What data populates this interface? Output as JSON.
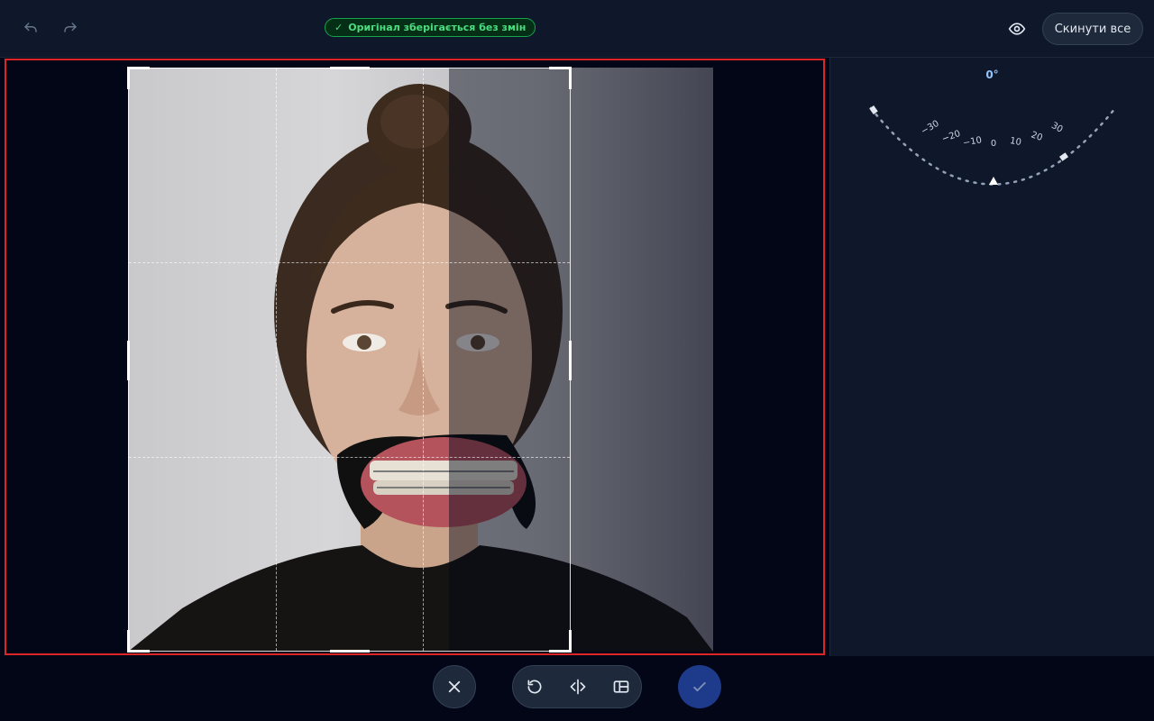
{
  "toolbar": {
    "undo_icon": "undo-icon",
    "redo_icon": "redo-icon",
    "status_badge": {
      "check": "✓",
      "text": "Оригінал зберігається без змін",
      "color": "#4ade80"
    },
    "preview_icon": "eye-icon",
    "reset_label": "Скинути все"
  },
  "editor": {
    "photo_alt": "portrait-photo",
    "crop_grid": "rule-of-thirds",
    "frame_color": "#dc2626"
  },
  "rotation": {
    "angle_label": "0°",
    "current_angle": 0,
    "ticks": [
      "−30",
      "−20",
      "−10",
      "0",
      "10",
      "20",
      "30"
    ]
  },
  "actions": {
    "cancel_icon": "close-icon",
    "rotate_icon": "rotate-left-icon",
    "flip_icon": "flip-horizontal-icon",
    "aspect_icon": "aspect-ratio-icon",
    "confirm_icon": "check-icon",
    "accent": "#1e3a8a"
  }
}
